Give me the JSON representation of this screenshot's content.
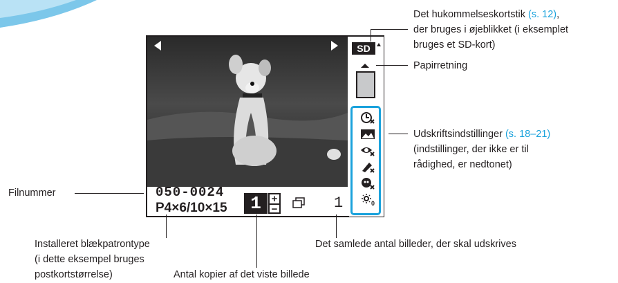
{
  "screen": {
    "file_number": "050-0024",
    "ink_type": "P4×6/10×15",
    "copies": "1",
    "plus": "+",
    "minus": "−",
    "total_images": "1",
    "memory_card": "SD",
    "photo_alt": "dog-photo"
  },
  "annotations": {
    "memory_card_line1": "Det hukommelseskortstik ",
    "memory_card_ref": "(s. 12)",
    "memory_card_line1_end": ",",
    "memory_card_line2": "der bruges i øjeblikket (i eksemplet",
    "memory_card_line3": "bruges et SD-kort)",
    "paper_orientation": "Papirretning",
    "print_settings_line1": "Udskriftsindstillinger ",
    "print_settings_ref": "(s. 18–21)",
    "print_settings_line2": "(indstillinger, der ikke er til",
    "print_settings_line3": "rådighed, er nedtonet)",
    "file_number_label": "Filnummer",
    "ink_line1": "Installeret blækpatrontype",
    "ink_line2": "(i dette eksempel bruges",
    "ink_line3": "postkortstørrelse)",
    "total_label": "Det samlede antal billeder, der skal udskrives",
    "copies_label": "Antal kopier af det viste billede"
  },
  "colors": {
    "accent": "#1aa2dc",
    "text": "#231f20"
  }
}
